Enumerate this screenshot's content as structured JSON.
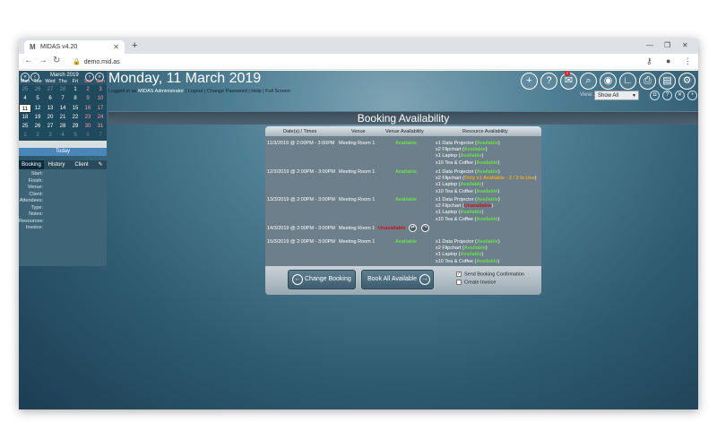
{
  "browser": {
    "tab_title": "MIDAS v4.20",
    "tab_favicon": "M",
    "url": "demo.mid.as"
  },
  "calendar": {
    "month": "March 2019",
    "day_names": [
      "Mon",
      "Tue",
      "Wed",
      "Thu",
      "Fri",
      "Sat",
      "Sun"
    ],
    "weeks": [
      [
        "25",
        "26",
        "27",
        "28",
        "1",
        "2",
        "3"
      ],
      [
        "4",
        "5",
        "6",
        "7",
        "8",
        "9",
        "10"
      ],
      [
        "11",
        "12",
        "13",
        "14",
        "15",
        "16",
        "17"
      ],
      [
        "18",
        "19",
        "20",
        "21",
        "22",
        "23",
        "24"
      ],
      [
        "25",
        "26",
        "27",
        "28",
        "29",
        "30",
        "31"
      ],
      [
        "1",
        "2",
        "3",
        "4",
        "5",
        "6",
        "7"
      ]
    ],
    "today_label": "Today"
  },
  "sidebar": {
    "tabs": [
      "Booking",
      "History",
      "Client"
    ],
    "fields": [
      "Start:",
      "Finish:",
      "Venue:",
      "Client:",
      "Attendees:",
      "Type:",
      "Notes:",
      "Resources:",
      "Invoice:"
    ]
  },
  "header": {
    "date": "Monday, 11 March 2019",
    "logged_in_prefix": "Logged in as",
    "user": "MIDAS Administrator",
    "links": "| Logout | Change Password | Help | Full Screen",
    "view_label": "View:",
    "view_value": "Show All",
    "badge_count": "2"
  },
  "section_title": "Booking Availability",
  "table": {
    "headers": [
      "Date(s) / Times",
      "Venue",
      "Venue Availability",
      "Resource Availability"
    ],
    "rows": [
      {
        "datetime": "11/3/2019 @ 2:00PM - 3:00PM",
        "venue": "Meeting Room 1",
        "venue_status": "Available",
        "resources": [
          {
            "name": "x1 Data Projector (",
            "status": "Available",
            "extra": "",
            "close": ")"
          },
          {
            "name": "x2 Flipchart (",
            "status": "Available",
            "extra": "",
            "close": ")"
          },
          {
            "name": "x1 Laptop (",
            "status": "Available",
            "extra": "",
            "close": ")"
          },
          {
            "name": "x10 Tea & Coffee (",
            "status": "Available",
            "extra": "",
            "close": ")"
          }
        ]
      },
      {
        "datetime": "12/3/2019 @ 2:00PM - 3:00PM",
        "venue": "Meeting Room 1",
        "venue_status": "Available",
        "resources": [
          {
            "name": "x1 Data Projector (",
            "status": "Available",
            "extra": "",
            "close": ")"
          },
          {
            "name": "x2 Flipchart (",
            "status": "Only x1 Available",
            "extra": " - 2 / 3 In Use",
            "close": ")"
          },
          {
            "name": "x1 Laptop (",
            "status": "Available",
            "extra": "",
            "close": ")"
          },
          {
            "name": "x10 Tea & Coffee (",
            "status": "Available",
            "extra": "",
            "close": ")"
          }
        ]
      },
      {
        "datetime": "13/3/2019 @ 2:00PM - 3:00PM",
        "venue": "Meeting Room 1",
        "venue_status": "Available",
        "resources": [
          {
            "name": "x1 Data Projector (",
            "status": "Available",
            "extra": "",
            "close": ")"
          },
          {
            "name": "x2 Flipchart (",
            "status": "Unavailable",
            "extra": "",
            "close": ")"
          },
          {
            "name": "x1 Laptop (",
            "status": "Available",
            "extra": "",
            "close": ")"
          },
          {
            "name": "x10 Tea & Coffee (",
            "status": "Available",
            "extra": "",
            "close": ")"
          }
        ]
      },
      {
        "datetime": "14/3/2019 @ 2:00PM - 3:00PM",
        "venue": "Meeting Room 1",
        "venue_status": "Unavailable",
        "resources": []
      },
      {
        "datetime": "15/3/2019 @ 2:00PM - 3:00PM",
        "venue": "Meeting Room 1",
        "venue_status": "Available",
        "resources": [
          {
            "name": "x1 Data Projector (",
            "status": "Available",
            "extra": "",
            "close": ")"
          },
          {
            "name": "x2 Flipchart (",
            "status": "Available",
            "extra": "",
            "close": ")"
          },
          {
            "name": "x1 Laptop (",
            "status": "Available",
            "extra": "",
            "close": ")"
          },
          {
            "name": "x10 Tea & Coffee (",
            "status": "Available",
            "extra": "",
            "close": ")"
          }
        ]
      }
    ]
  },
  "footer": {
    "change_booking": "Change Booking",
    "book_all": "Book All Available",
    "send_confirmation": "Send Booking Confirmation",
    "create_invoice": "Create Invoice",
    "send_confirmation_checked": true,
    "create_invoice_checked": false
  },
  "colors": {
    "available": "#68e04c",
    "partial": "#f4a624",
    "unavailable": "#c8141a"
  }
}
